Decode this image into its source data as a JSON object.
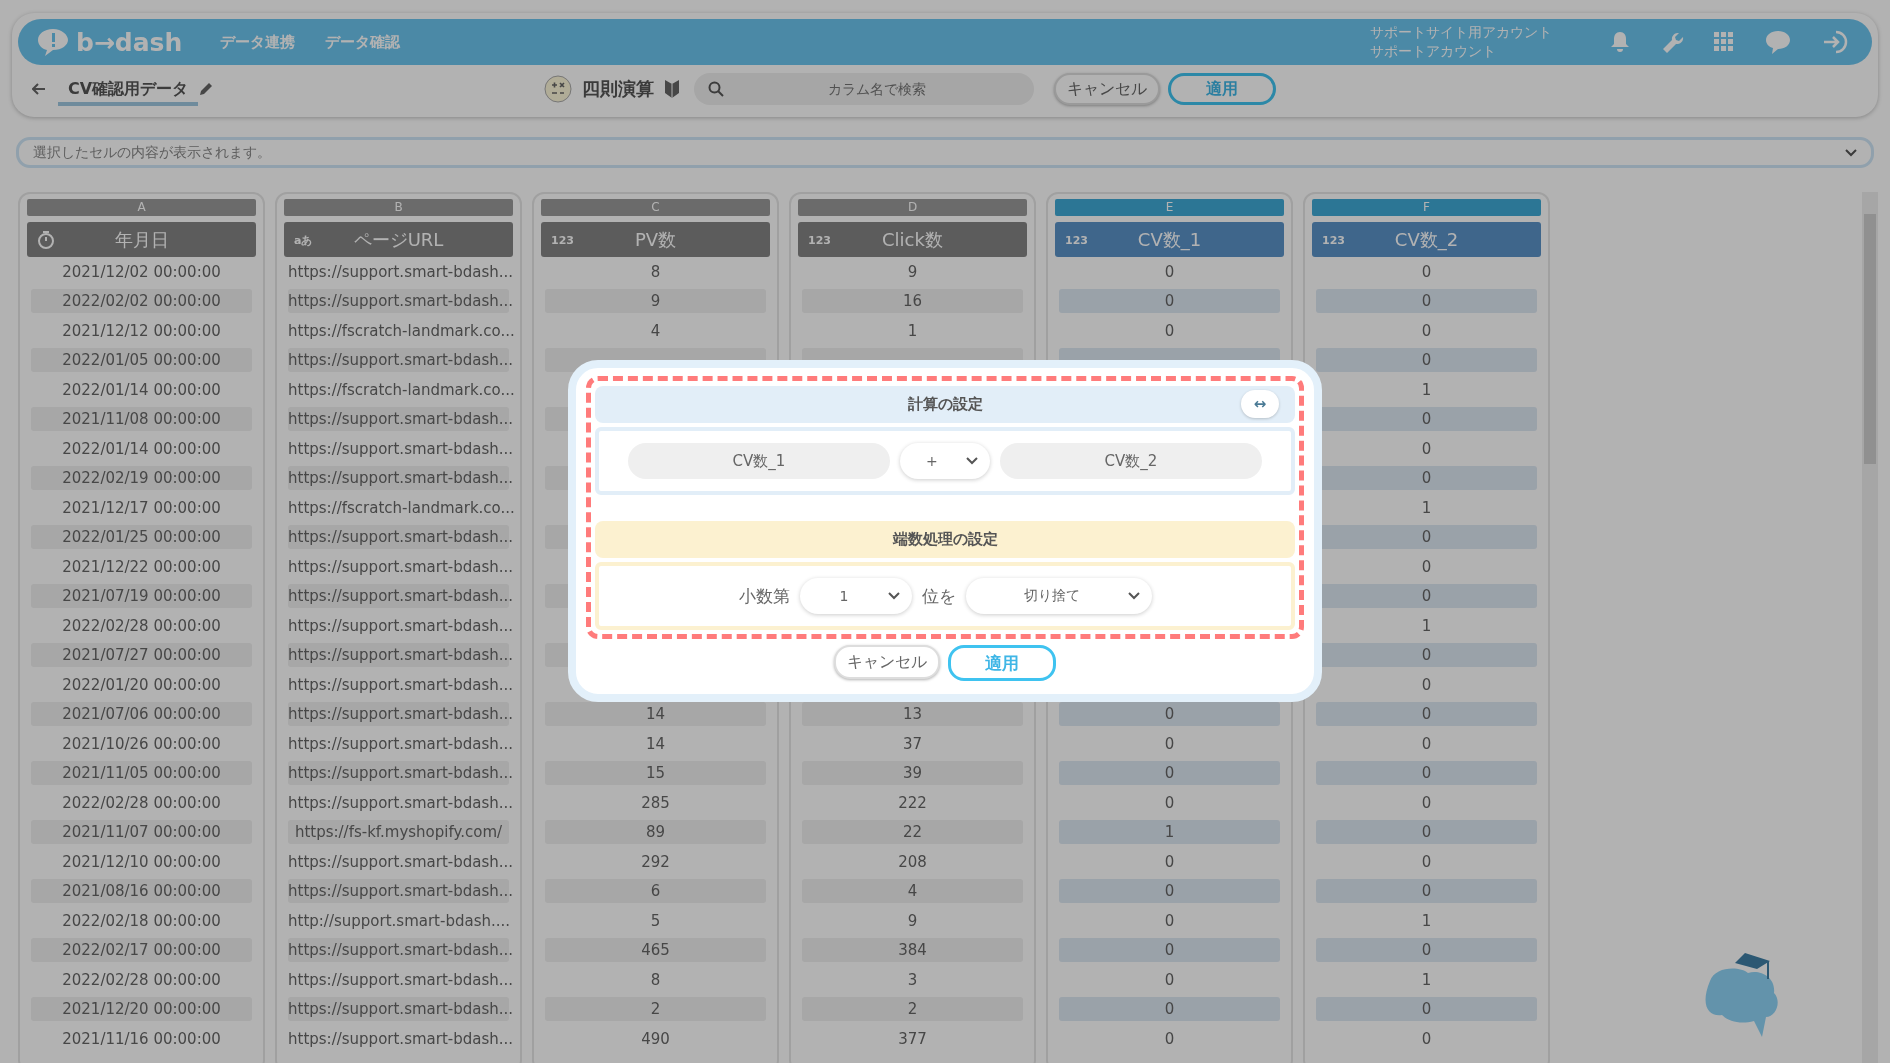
{
  "header": {
    "logo": "b→dash",
    "nav": [
      {
        "label": "データ連携"
      },
      {
        "label": "データ確認"
      }
    ],
    "account": {
      "line1": "サポートサイト用アカウント",
      "line2": "サポートアカウント"
    }
  },
  "toolbar": {
    "title": "CV確認用データ",
    "mode": "四則演算",
    "search": {
      "placeholder": "カラム名で検索"
    },
    "cancel": "キャンセル",
    "apply": "適用"
  },
  "cell_preview": {
    "placeholder": "選択したセルの内容が表示されます。"
  },
  "columns": [
    {
      "letter": "A",
      "name": "年月日",
      "kind": "date",
      "selected": false
    },
    {
      "letter": "B",
      "name": "ページURL",
      "kind": "text",
      "icon_text": "aあ",
      "selected": false
    },
    {
      "letter": "C",
      "name": "PV数",
      "kind": "number",
      "icon_text": "123",
      "selected": false
    },
    {
      "letter": "D",
      "name": "Click数",
      "kind": "number",
      "icon_text": "123",
      "selected": false
    },
    {
      "letter": "E",
      "name": "CV数_1",
      "kind": "number",
      "icon_text": "123",
      "selected": true
    },
    {
      "letter": "F",
      "name": "CV数_2",
      "kind": "number",
      "icon_text": "123",
      "selected": true
    }
  ],
  "rows": [
    [
      "2021/12/02 00:00:00",
      "https://support.smart-bdash...",
      "8",
      "9",
      "0",
      "0"
    ],
    [
      "2022/02/02 00:00:00",
      "https://support.smart-bdash...",
      "9",
      "16",
      "0",
      "0"
    ],
    [
      "2021/12/12 00:00:00",
      "https://fscratch-landmark.co...",
      "4",
      "1",
      "0",
      "0"
    ],
    [
      "2022/01/05 00:00:00",
      "https://support.smart-bdash...",
      null,
      null,
      null,
      "0"
    ],
    [
      "2022/01/14 00:00:00",
      "https://fscratch-landmark.co...",
      null,
      null,
      null,
      "1"
    ],
    [
      "2021/11/08 00:00:00",
      "https://support.smart-bdash...",
      null,
      null,
      null,
      "0"
    ],
    [
      "2022/01/14 00:00:00",
      "https://support.smart-bdash...",
      null,
      null,
      null,
      "0"
    ],
    [
      "2022/02/19 00:00:00",
      "https://support.smart-bdash...",
      null,
      null,
      null,
      "0"
    ],
    [
      "2021/12/17 00:00:00",
      "https://fscratch-landmark.co...",
      null,
      null,
      null,
      "1"
    ],
    [
      "2022/01/25 00:00:00",
      "https://support.smart-bdash...",
      null,
      null,
      null,
      "0"
    ],
    [
      "2021/12/22 00:00:00",
      "https://support.smart-bdash...",
      null,
      null,
      null,
      "0"
    ],
    [
      "2021/07/19 00:00:00",
      "https://support.smart-bdash...",
      null,
      null,
      null,
      "0"
    ],
    [
      "2022/02/28 00:00:00",
      "https://support.smart-bdash...",
      null,
      null,
      null,
      "1"
    ],
    [
      "2021/07/27 00:00:00",
      "https://support.smart-bdash...",
      null,
      null,
      null,
      "0"
    ],
    [
      "2022/01/20 00:00:00",
      "https://support.smart-bdash...",
      null,
      null,
      null,
      "0"
    ],
    [
      "2021/07/06 00:00:00",
      "https://support.smart-bdash...",
      "14",
      "13",
      "0",
      "0"
    ],
    [
      "2021/10/26 00:00:00",
      "https://support.smart-bdash...",
      "14",
      "37",
      "0",
      "0"
    ],
    [
      "2021/11/05 00:00:00",
      "https://support.smart-bdash...",
      "15",
      "39",
      "0",
      "0"
    ],
    [
      "2022/02/28 00:00:00",
      "https://support.smart-bdash...",
      "285",
      "222",
      "0",
      "0"
    ],
    [
      "2021/11/07 00:00:00",
      "https://fs-kf.myshopify.com/",
      "89",
      "22",
      "1",
      "0"
    ],
    [
      "2021/12/10 00:00:00",
      "https://support.smart-bdash...",
      "292",
      "208",
      "0",
      "0"
    ],
    [
      "2021/08/16 00:00:00",
      "https://support.smart-bdash...",
      "6",
      "4",
      "0",
      "0"
    ],
    [
      "2022/02/18 00:00:00",
      "http://support.smart-bdash....",
      "5",
      "9",
      "0",
      "1"
    ],
    [
      "2022/02/17 00:00:00",
      "https://support.smart-bdash...",
      "465",
      "384",
      "0",
      "0"
    ],
    [
      "2022/02/28 00:00:00",
      "https://support.smart-bdash...",
      "8",
      "3",
      "0",
      "1"
    ],
    [
      "2021/12/20 00:00:00",
      "https://support.smart-bdash...",
      "2",
      "2",
      "0",
      "0"
    ],
    [
      "2021/11/16 00:00:00",
      "https://support.smart-bdash...",
      "490",
      "377",
      "0",
      "0"
    ]
  ],
  "dialog": {
    "calc_title": "計算の設定",
    "swap": "↔",
    "left_operand": "CV数_1",
    "operator": "+",
    "right_operand": "CV数_2",
    "rounding_title": "端数処理の設定",
    "prefix": "小数第",
    "digit": "1",
    "middle": "位を",
    "method": "切り捨て",
    "cancel": "キャンセル",
    "apply": "適用"
  }
}
